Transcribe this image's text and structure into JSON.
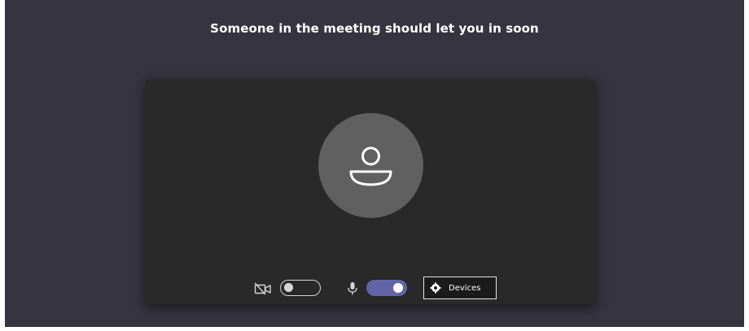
{
  "lobby": {
    "message": "Someone in the meeting should let you in soon"
  },
  "avatar": {
    "icon": "person-icon"
  },
  "controls": {
    "camera": {
      "icon": "camera-icon",
      "enabled": false
    },
    "microphone": {
      "icon": "microphone-icon",
      "enabled": true
    },
    "devices_label": "Devices",
    "devices_icon": "gear-icon"
  },
  "colors": {
    "background": "#35343f",
    "card": "#292929",
    "avatar": "#606060",
    "toggle_on": "#6264a7",
    "text": "#ffffff"
  }
}
